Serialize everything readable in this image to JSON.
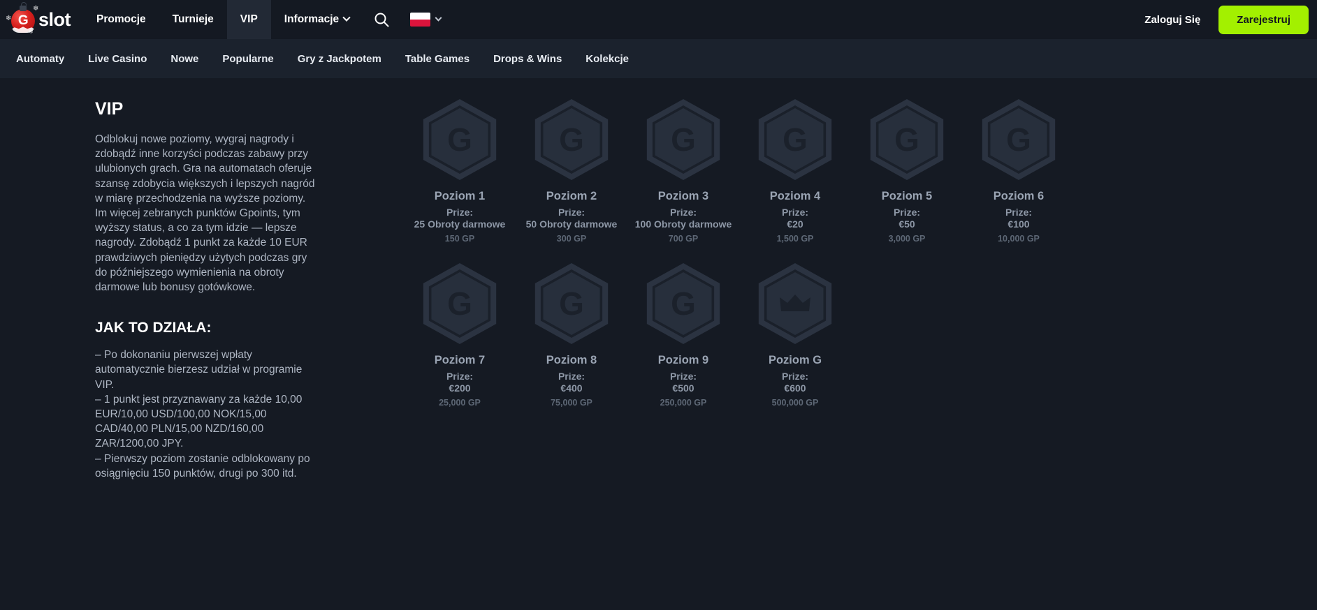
{
  "brand": {
    "logo_letter": "G",
    "logo_text": "slot"
  },
  "topnav": {
    "items": [
      {
        "label": "Promocje",
        "active": false,
        "dropdown": false
      },
      {
        "label": "Turnieje",
        "active": false,
        "dropdown": false
      },
      {
        "label": "VIP",
        "active": true,
        "dropdown": false
      },
      {
        "label": "Informacje",
        "active": false,
        "dropdown": true
      }
    ],
    "search_icon": "search-icon",
    "language": "PL",
    "login_label": "Zaloguj Się",
    "register_label": "Zarejestruj",
    "register_color": "#a3f000"
  },
  "subnav": {
    "items": [
      "Automaty",
      "Live Casino",
      "Nowe",
      "Popularne",
      "Gry z Jackpotem",
      "Table Games",
      "Drops & Wins",
      "Kolekcje"
    ]
  },
  "content": {
    "title": "VIP",
    "intro": "Odblokuj nowe poziomy, wygraj nagrody i zdobądź inne korzyści podczas zabawy przy ulubionych grach. Gra na automatach oferuje szansę zdobycia większych i lepszych nagród w miarę przechodzenia na wyższe poziomy. Im więcej zebranych punktów Gpoints, tym wyższy status, a co za tym idzie — lepsze nagrody. Zdobądź 1 punkt za każde 10 EUR prawdziwych pieniędzy użytych podczas gry do późniejszego wymienienia na obroty darmowe lub bonusy gotówkowe.",
    "howto_title": "JAK TO DZIAŁA:",
    "howto_lines": [
      "– Po dokonaniu pierwszej wpłaty automatycznie bierzesz udział w programie VIP.",
      "– 1 punkt jest przyznawany za każde 10,00 EUR/10,00 USD/100,00 NOK/15,00 CAD/40,00 PLN/15,00 NZD/160,00 ZAR/1200,00 JPY.",
      "– Pierwszy poziom zostanie odblokowany po osiągnięciu 150 punktów, drugi po 300 itd."
    ]
  },
  "levels": {
    "prize_label": "Prize:",
    "row1": [
      {
        "name": "Poziom 1",
        "prize": "25 Obroty darmowe",
        "gp": "150 GP",
        "icon": "g-hex-badge-icon"
      },
      {
        "name": "Poziom 2",
        "prize": "50 Obroty darmowe",
        "gp": "300 GP",
        "icon": "g-hex-badge-icon"
      },
      {
        "name": "Poziom 3",
        "prize": "100 Obroty darmowe",
        "gp": "700 GP",
        "icon": "g-hex-badge-icon"
      },
      {
        "name": "Poziom 4",
        "prize": "€20",
        "gp": "1,500 GP",
        "icon": "g-hex-badge-icon"
      },
      {
        "name": "Poziom 5",
        "prize": "€50",
        "gp": "3,000 GP",
        "icon": "g-hex-badge-icon"
      },
      {
        "name": "Poziom 6",
        "prize": "€100",
        "gp": "10,000 GP",
        "icon": "g-hex-badge-icon"
      }
    ],
    "row2": [
      {
        "name": "Poziom 7",
        "prize": "€200",
        "gp": "25,000 GP",
        "icon": "g-hex-badge-icon"
      },
      {
        "name": "Poziom 8",
        "prize": "€400",
        "gp": "75,000 GP",
        "icon": "g-hex-badge-icon"
      },
      {
        "name": "Poziom 9",
        "prize": "€500",
        "gp": "250,000 GP",
        "icon": "g-hex-badge-icon"
      },
      {
        "name": "Poziom G",
        "prize": "€600",
        "gp": "500,000 GP",
        "icon": "crown-hex-badge-icon"
      }
    ]
  }
}
